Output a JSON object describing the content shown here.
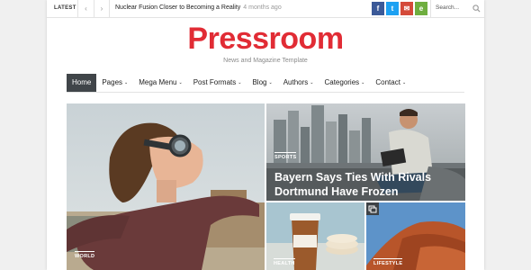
{
  "topbar": {
    "latest_label": "LATEST",
    "prev_symbol": "‹",
    "next_symbol": "›",
    "ticker_headline": "Nuclear Fusion Closer to Becoming a Reality",
    "ticker_time": "4 months ago",
    "social": [
      {
        "icon": "facebook-icon",
        "symbol": "f",
        "color": "#3b5998"
      },
      {
        "icon": "twitter-icon",
        "symbol": "t",
        "color": "#1da1f2"
      },
      {
        "icon": "mail-icon",
        "symbol": "✉",
        "color": "#d44a3a"
      },
      {
        "icon": "evernote-icon",
        "symbol": "e",
        "color": "#6fae3f"
      }
    ],
    "search_placeholder": "Search..."
  },
  "header": {
    "logo": "Pressroom",
    "tagline": "News and Magazine Template",
    "logo_color": "#e12c35"
  },
  "menu": {
    "items": [
      {
        "label": "Home",
        "active": true
      },
      {
        "label": "Pages"
      },
      {
        "label": "Mega Menu"
      },
      {
        "label": "Post Formats"
      },
      {
        "label": "Blog"
      },
      {
        "label": "Authors"
      },
      {
        "label": "Categories"
      },
      {
        "label": "Contact"
      }
    ],
    "caret": "⌄"
  },
  "featured": {
    "main": {
      "category": "WORLD"
    },
    "top_right": {
      "category": "SPORTS",
      "headline": "Bayern Says Ties With Rivals Dortmund Have Frozen"
    },
    "bottom_left": {
      "category": "HEALTH"
    },
    "bottom_right": {
      "category": "LIFESTYLE",
      "icon": "gallery-icon"
    }
  }
}
